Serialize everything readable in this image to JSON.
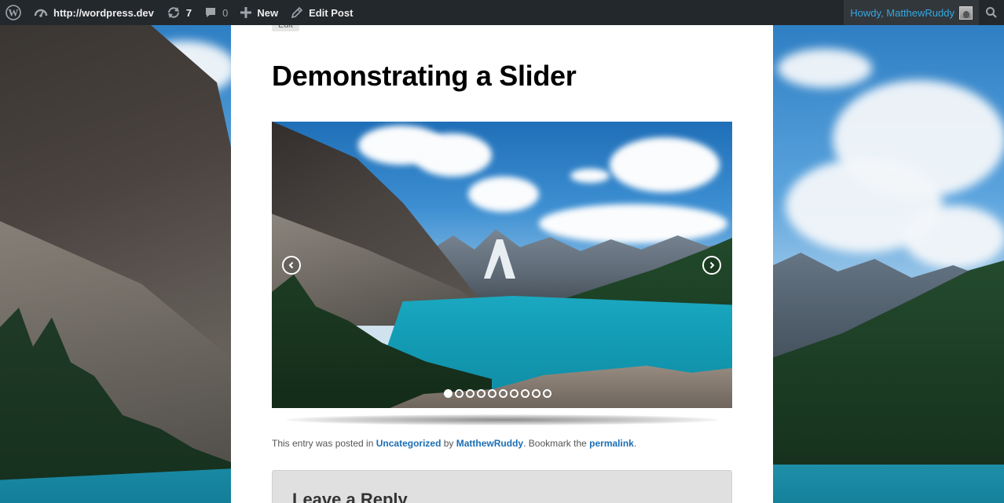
{
  "adminbar": {
    "wp_logo_icon": "wordpress-logo",
    "site_url": "http://wordpress.dev",
    "updates_count": "7",
    "comments_count": "0",
    "new_label": "New",
    "edit_post_label": "Edit Post",
    "howdy": "Howdy, MatthewRuddy"
  },
  "post": {
    "edit_label": "Edit",
    "title": "Demonstrating a Slider"
  },
  "slider": {
    "slide_count": 10,
    "active_index": 0
  },
  "meta": {
    "prefix": "This entry was posted in ",
    "category": "Uncategorized",
    "by": " by ",
    "author": "MatthewRuddy",
    "bookmark": ". Bookmark the ",
    "permalink": "permalink",
    "suffix": "."
  },
  "comments": {
    "reply_title": "Leave a Reply"
  },
  "colors": {
    "adminbar_bg": "#23282d",
    "link": "#1b6fb5",
    "howdy": "#35a8e0"
  }
}
